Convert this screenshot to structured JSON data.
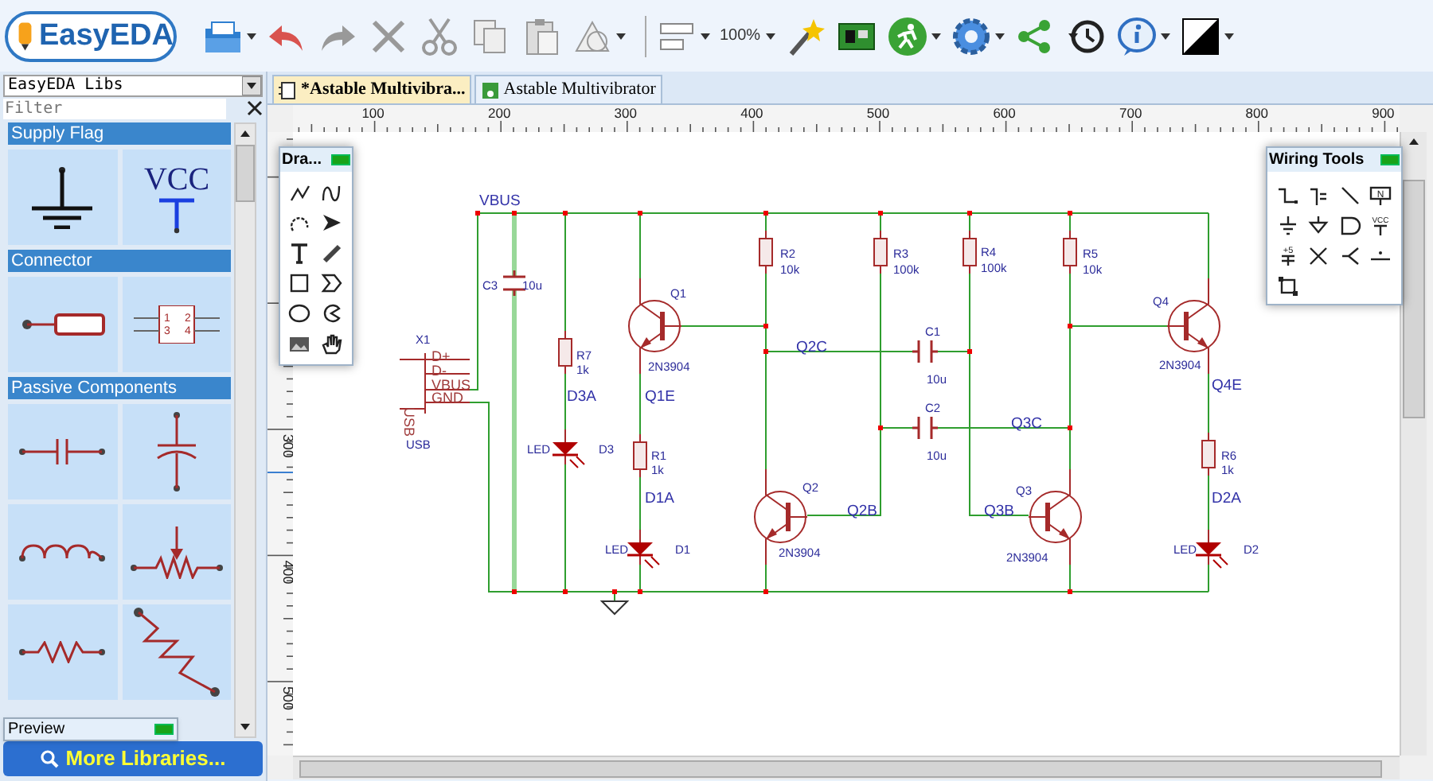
{
  "toolbar": {
    "logo": "EasyEDA",
    "zoom": "100%"
  },
  "library_panel": {
    "source": "EasyEDA Libs",
    "filter": {
      "placeholder": "Filter"
    },
    "categories": [
      {
        "title": "Supply Flag",
        "tiles": [
          {
            "kind": "ground"
          },
          {
            "kind": "vcc",
            "label": "VCC"
          }
        ]
      },
      {
        "title": "Connector",
        "tiles": [
          {
            "kind": "header"
          },
          {
            "kind": "ic",
            "pins": [
              "1",
              "2",
              "3",
              "4"
            ]
          }
        ]
      },
      {
        "title": "Passive Components",
        "tiles": [
          {
            "kind": "capacitor"
          },
          {
            "kind": "polar-capacitor"
          },
          {
            "kind": "inductor"
          },
          {
            "kind": "potentiometer"
          },
          {
            "kind": "resistor"
          },
          {
            "kind": "resistor-diagonal"
          }
        ]
      }
    ],
    "preview": {
      "title": "Preview"
    },
    "more_button": "More Libraries..."
  },
  "tabs": [
    {
      "label": "*Astable Multivibra...",
      "selected": true
    },
    {
      "label": "Astable Multivibrator",
      "selected": false
    }
  ],
  "rulers": {
    "horizontal": [
      "100",
      "200",
      "300",
      "400",
      "500",
      "600",
      "700",
      "800",
      "900"
    ],
    "vertical": [
      "300",
      "400",
      "500"
    ]
  },
  "drawing_tools": {
    "title": "Dra...",
    "items": [
      {
        "kind": "polyline"
      },
      {
        "kind": "bezier"
      },
      {
        "kind": "arc"
      },
      {
        "kind": "arrow"
      },
      {
        "kind": "text"
      },
      {
        "kind": "pencil"
      },
      {
        "kind": "rectangle"
      },
      {
        "kind": "polygon"
      },
      {
        "kind": "circle"
      },
      {
        "kind": "pie"
      },
      {
        "kind": "image"
      },
      {
        "kind": "hand"
      }
    ]
  },
  "wiring_tools": {
    "title": "Wiring Tools",
    "items": [
      {
        "kind": "wire"
      },
      {
        "kind": "bus"
      },
      {
        "kind": "line"
      },
      {
        "kind": "netlabel",
        "label": "N"
      },
      {
        "kind": "ground"
      },
      {
        "kind": "ground-arrow"
      },
      {
        "kind": "port"
      },
      {
        "kind": "vcc",
        "label": "VCC"
      },
      {
        "kind": "plus",
        "label": "+5"
      },
      {
        "kind": "no-connect"
      },
      {
        "kind": "bus-entry"
      },
      {
        "kind": "pin"
      },
      {
        "kind": "select"
      }
    ]
  },
  "schematic": {
    "labels": [
      {
        "text": "VBUS",
        "kind": "net"
      },
      {
        "text": "C3",
        "kind": "part"
      },
      {
        "text": "10u",
        "kind": "part"
      },
      {
        "text": "X1",
        "kind": "part"
      },
      {
        "text": "D+",
        "kind": "pin"
      },
      {
        "text": "D-",
        "kind": "pin"
      },
      {
        "text": "VBUS",
        "kind": "pin"
      },
      {
        "text": "GND",
        "kind": "pin"
      },
      {
        "text": "USB",
        "kind": "pin"
      },
      {
        "text": "USB",
        "kind": "part"
      },
      {
        "text": "R7",
        "kind": "part"
      },
      {
        "text": "1k",
        "kind": "part"
      },
      {
        "text": "D3A",
        "kind": "net"
      },
      {
        "text": "LED",
        "kind": "part"
      },
      {
        "text": "D3",
        "kind": "part"
      },
      {
        "text": "Q1",
        "kind": "part"
      },
      {
        "text": "2N3904",
        "kind": "part"
      },
      {
        "text": "Q1E",
        "kind": "net"
      },
      {
        "text": "R1",
        "kind": "part"
      },
      {
        "text": "1k",
        "kind": "part"
      },
      {
        "text": "D1A",
        "kind": "net"
      },
      {
        "text": "LED",
        "kind": "part"
      },
      {
        "text": "D1",
        "kind": "part"
      },
      {
        "text": "R2",
        "kind": "part"
      },
      {
        "text": "10k",
        "kind": "part"
      },
      {
        "text": "R3",
        "kind": "part"
      },
      {
        "text": "100k",
        "kind": "part"
      },
      {
        "text": "R4",
        "kind": "part"
      },
      {
        "text": "100k",
        "kind": "part"
      },
      {
        "text": "R5",
        "kind": "part"
      },
      {
        "text": "10k",
        "kind": "part"
      },
      {
        "text": "Q2C",
        "kind": "net"
      },
      {
        "text": "C1",
        "kind": "part"
      },
      {
        "text": "10u",
        "kind": "part"
      },
      {
        "text": "C2",
        "kind": "part"
      },
      {
        "text": "10u",
        "kind": "part"
      },
      {
        "text": "Q3C",
        "kind": "net"
      },
      {
        "text": "Q2",
        "kind": "part"
      },
      {
        "text": "2N3904",
        "kind": "part"
      },
      {
        "text": "Q2B",
        "kind": "net"
      },
      {
        "text": "Q3B",
        "kind": "net"
      },
      {
        "text": "Q3",
        "kind": "part"
      },
      {
        "text": "2N3904",
        "kind": "part"
      },
      {
        "text": "Q4",
        "kind": "part"
      },
      {
        "text": "2N3904",
        "kind": "part"
      },
      {
        "text": "Q4E",
        "kind": "net"
      },
      {
        "text": "R6",
        "kind": "part"
      },
      {
        "text": "1k",
        "kind": "part"
      },
      {
        "text": "D2A",
        "kind": "net"
      },
      {
        "text": "LED",
        "kind": "part"
      },
      {
        "text": "D2",
        "kind": "part"
      }
    ]
  }
}
